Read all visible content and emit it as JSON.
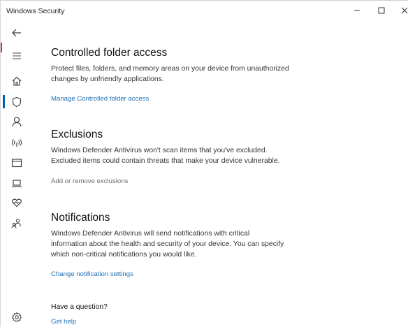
{
  "window": {
    "title": "Windows Security"
  },
  "sidebar": {
    "items": [
      {
        "icon": "back-arrow-icon",
        "interactable": true
      },
      {
        "icon": "hamburger-menu-icon",
        "interactable": true
      },
      {
        "icon": "home-icon",
        "interactable": true
      },
      {
        "icon": "shield-icon",
        "interactable": true,
        "active": true
      },
      {
        "icon": "person-icon",
        "interactable": true
      },
      {
        "icon": "wireless-icon",
        "interactable": true
      },
      {
        "icon": "app-browser-icon",
        "interactable": true
      },
      {
        "icon": "laptop-icon",
        "interactable": true
      },
      {
        "icon": "heart-icon",
        "interactable": true
      },
      {
        "icon": "family-icon",
        "interactable": true
      },
      {
        "icon": "gear-icon",
        "interactable": true
      }
    ],
    "accent": "#0063b1"
  },
  "sections": {
    "controlled": {
      "heading": "Controlled folder access",
      "line1": "Protect files, folders, and memory areas on your device from unauthorized",
      "line2": "changes by unfriendly applications.",
      "link": "Manage Controlled folder access"
    },
    "exclusions": {
      "heading": "Exclusions",
      "line1": "Windows Defender Antivirus won't scan items that you've excluded.",
      "line2": "Excluded items could contain threats that make your device vulnerable.",
      "link": "Add or remove exclusions"
    },
    "notifications": {
      "heading": "Notifications",
      "line1": "Windows Defender Antivirus will send notifications with critical",
      "line2": "information about the health and security of your device. You can specify",
      "line3": "which non-critical notifications you would like.",
      "link": "Change notification settings"
    },
    "help": {
      "question": "Have a question?",
      "link": "Get help"
    }
  },
  "colors": {
    "link": "#1f6fb5",
    "link_disabled": "#6b6b6b"
  }
}
